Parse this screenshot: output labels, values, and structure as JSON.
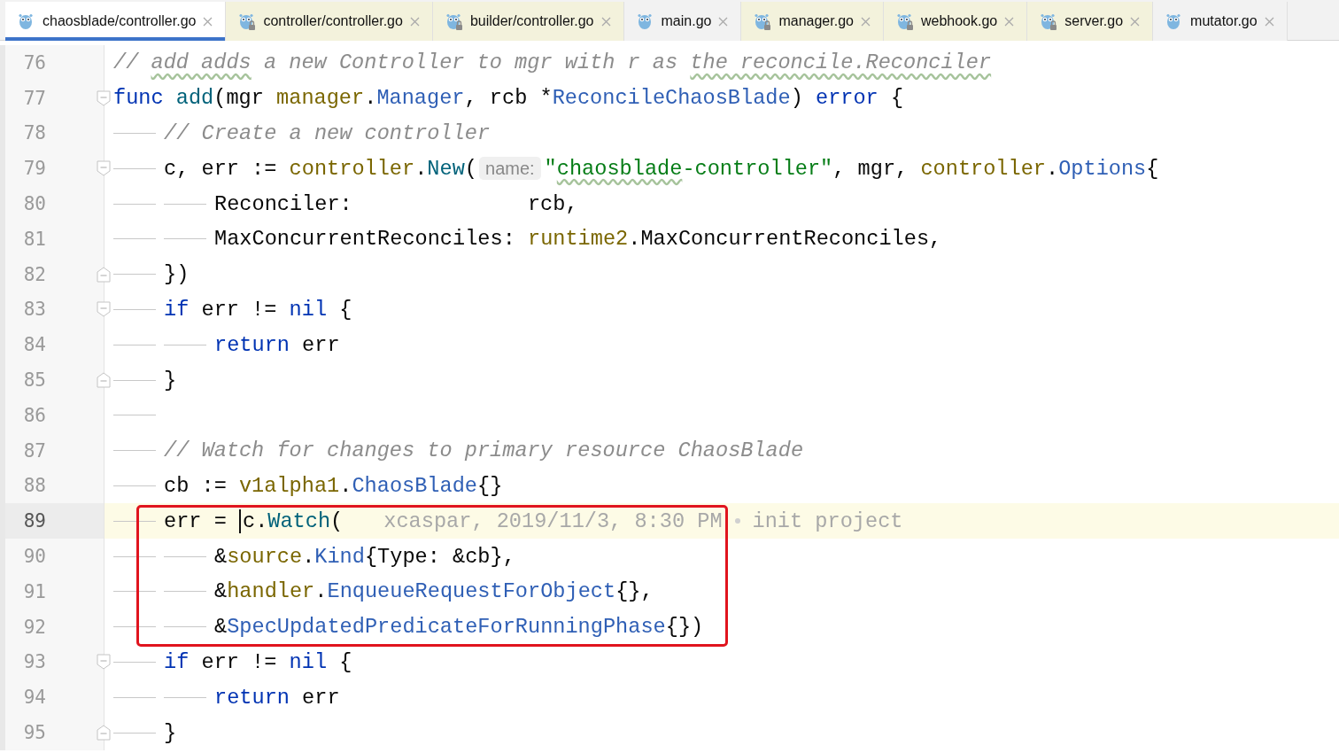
{
  "tabs": [
    {
      "label": "chaosblade/controller.go",
      "selected": true,
      "locked": false
    },
    {
      "label": "controller/controller.go",
      "selected": false,
      "locked": true
    },
    {
      "label": "builder/controller.go",
      "selected": false,
      "locked": true
    },
    {
      "label": "main.go",
      "selected": false,
      "locked": false
    },
    {
      "label": "manager.go",
      "selected": false,
      "locked": true
    },
    {
      "label": "webhook.go",
      "selected": false,
      "locked": true
    },
    {
      "label": "server.go",
      "selected": false,
      "locked": true
    },
    {
      "label": "mutator.go",
      "selected": false,
      "locked": false
    }
  ],
  "editor": {
    "lines": [
      {
        "number": "76",
        "tokens": [
          {
            "kind": "comment",
            "text": "// "
          },
          {
            "kind": "comment",
            "text": "add adds",
            "typo": true
          },
          {
            "kind": "comment",
            "text": " a new Controller to mgr with r as "
          },
          {
            "kind": "comment",
            "text": "the reconcile.Reconciler",
            "typo": true
          }
        ]
      },
      {
        "number": "77",
        "fold_open": true,
        "tokens": [
          {
            "kind": "keyword",
            "text": "func"
          },
          {
            "kind": "function",
            "text": " add"
          },
          {
            "kind": "plain",
            "text": "(mgr "
          },
          {
            "kind": "package",
            "text": "manager"
          },
          {
            "kind": "plain",
            "text": "."
          },
          {
            "kind": "type",
            "text": "Manager"
          },
          {
            "kind": "plain",
            "text": ", rcb *"
          },
          {
            "kind": "type",
            "text": "ReconcileChaosBlade"
          },
          {
            "kind": "plain",
            "text": ") "
          },
          {
            "kind": "keyword",
            "text": "error"
          },
          {
            "kind": "plain",
            "text": " {"
          }
        ],
        "children": [
          {
            "number": "78",
            "tokens": [
              {
                "kind": "comment",
                "text": "// Create a new controller"
              }
            ]
          },
          {
            "number": "79",
            "fold_open": true,
            "tokens": [
              {
                "kind": "plain",
                "text": "c, err := "
              },
              {
                "kind": "package",
                "text": "controller"
              },
              {
                "kind": "plain",
                "text": "."
              },
              {
                "kind": "function",
                "text": "New"
              },
              {
                "kind": "plain",
                "text": "("
              },
              {
                "kind": "hint",
                "text": "name:"
              },
              {
                "kind": "string",
                "text": "\""
              },
              {
                "kind": "string",
                "text": "chaosblade",
                "typo": true
              },
              {
                "kind": "string",
                "text": "-controller\""
              },
              {
                "kind": "plain",
                "text": ", mgr, "
              },
              {
                "kind": "package",
                "text": "controller"
              },
              {
                "kind": "plain",
                "text": "."
              },
              {
                "kind": "type",
                "text": "Options"
              },
              {
                "kind": "plain",
                "text": "{"
              }
            ],
            "children": [
              {
                "number": "80",
                "tokens": [
                  {
                    "kind": "plain",
                    "text": "Reconciler:              rcb,"
                  }
                ]
              },
              {
                "number": "81",
                "tokens": [
                  {
                    "kind": "plain",
                    "text": "MaxConcurrentReconciles: "
                  },
                  {
                    "kind": "package",
                    "text": "runtime2"
                  },
                  {
                    "kind": "plain",
                    "text": ".MaxConcurrentReconciles,"
                  }
                ]
              }
            ]
          },
          {
            "number": "82",
            "fold_close": true,
            "tokens": [
              {
                "kind": "plain",
                "text": "})"
              }
            ]
          },
          {
            "number": "83",
            "fold_open": true,
            "tokens": [
              {
                "kind": "keyword",
                "text": "if"
              },
              {
                "kind": "plain",
                "text": " err != "
              },
              {
                "kind": "keyword",
                "text": "nil"
              },
              {
                "kind": "plain",
                "text": " {"
              }
            ],
            "children": [
              {
                "number": "84",
                "tokens": [
                  {
                    "kind": "keyword",
                    "text": "return"
                  },
                  {
                    "kind": "plain",
                    "text": " err"
                  }
                ]
              }
            ]
          },
          {
            "number": "85",
            "fold_close": true,
            "tokens": [
              {
                "kind": "plain",
                "text": "}"
              }
            ]
          },
          {
            "number": "86"
          },
          {
            "number": "87",
            "tokens": [
              {
                "kind": "comment",
                "text": "// Watch for changes to primary resource ChaosBlade"
              }
            ]
          },
          {
            "number": "88",
            "tokens": [
              {
                "kind": "plain",
                "text": "cb := "
              },
              {
                "kind": "package",
                "text": "v1alpha1"
              },
              {
                "kind": "plain",
                "text": "."
              },
              {
                "kind": "type",
                "text": "ChaosBlade"
              },
              {
                "kind": "plain",
                "text": "{}"
              }
            ]
          },
          {
            "number": "89",
            "current": true,
            "boxed": true,
            "tokens": [
              {
                "kind": "plain",
                "text": "err = "
              },
              {
                "kind": "plain",
                "text": "c",
                "caret": true
              },
              {
                "kind": "plain",
                "text": "."
              },
              {
                "kind": "function",
                "text": "Watch"
              },
              {
                "kind": "plain",
                "text": "("
              }
            ],
            "blame": {
              "text": "xcaspar, 2019/11/3, 8:30 PM",
              "message": "init project"
            },
            "children": [
              {
                "number": "90",
                "tokens": [
                  {
                    "kind": "plain",
                    "text": "&"
                  },
                  {
                    "kind": "package",
                    "text": "source"
                  },
                  {
                    "kind": "plain",
                    "text": "."
                  },
                  {
                    "kind": "type",
                    "text": "Kind"
                  },
                  {
                    "kind": "plain",
                    "text": "{Type: &cb},"
                  }
                ]
              },
              {
                "number": "91",
                "tokens": [
                  {
                    "kind": "plain",
                    "text": "&"
                  },
                  {
                    "kind": "package",
                    "text": "handler"
                  },
                  {
                    "kind": "plain",
                    "text": "."
                  },
                  {
                    "kind": "type",
                    "text": "EnqueueRequestForObject"
                  },
                  {
                    "kind": "plain",
                    "text": "{},"
                  }
                ]
              },
              {
                "number": "92",
                "tokens": [
                  {
                    "kind": "plain",
                    "text": "&"
                  },
                  {
                    "kind": "type",
                    "text": "SpecUpdatedPredicateForRunningPhase"
                  },
                  {
                    "kind": "plain",
                    "text": "{})"
                  }
                ]
              }
            ]
          },
          {
            "number": "93",
            "fold_open": true,
            "tokens": [
              {
                "kind": "keyword",
                "text": "if"
              },
              {
                "kind": "plain",
                "text": " err != "
              },
              {
                "kind": "keyword",
                "text": "nil"
              },
              {
                "kind": "plain",
                "text": " {"
              }
            ],
            "children": [
              {
                "number": "94",
                "tokens": [
                  {
                    "kind": "keyword",
                    "text": "return"
                  },
                  {
                    "kind": "plain",
                    "text": " err"
                  }
                ]
              }
            ]
          },
          {
            "number": "95",
            "fold_close": true,
            "tokens": [
              {
                "kind": "plain",
                "text": "}"
              }
            ]
          }
        ]
      }
    ]
  }
}
